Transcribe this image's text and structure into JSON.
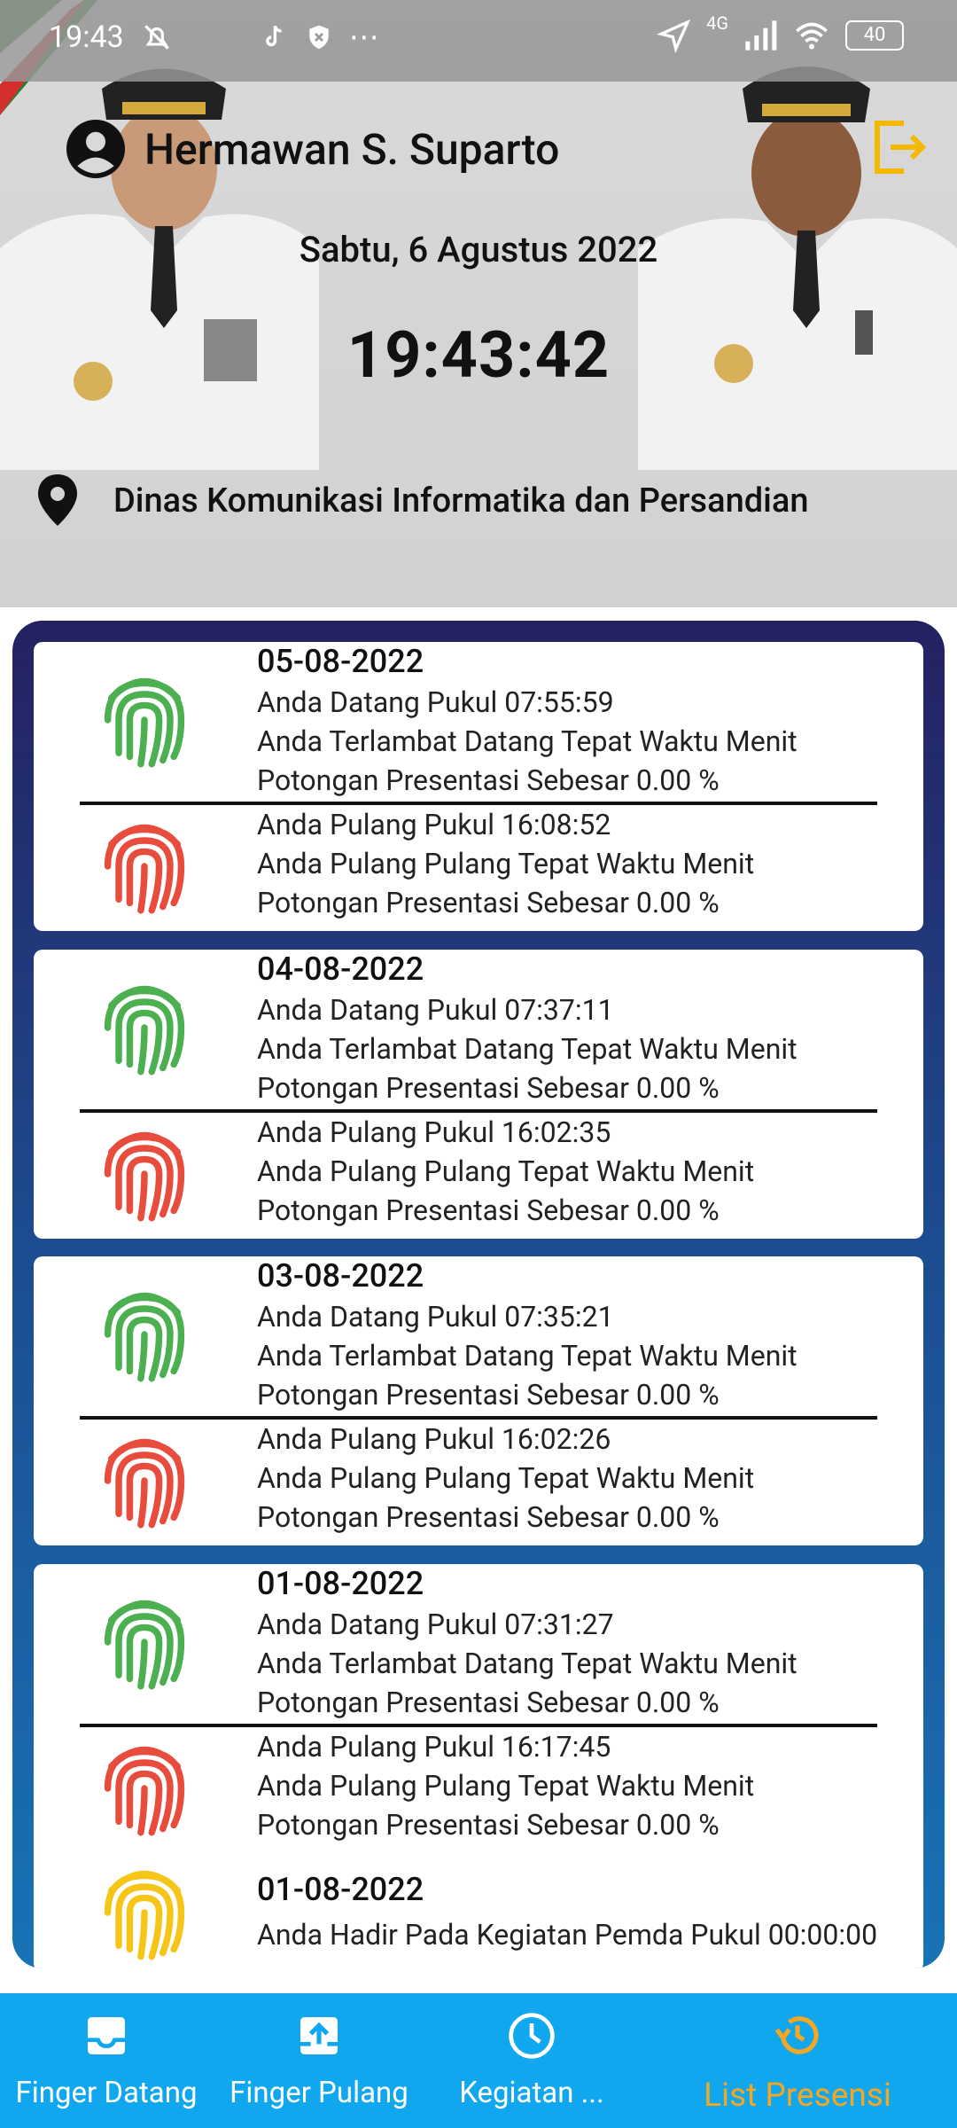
{
  "status_bar": {
    "time": "19:43",
    "network": "4G",
    "battery": "40"
  },
  "header": {
    "user_name": "Hermawan S. Suparto",
    "date": "Sabtu, 6 Agustus 2022",
    "clock": "19:43:42",
    "location": "Dinas Komunikasi Informatika dan Persandian"
  },
  "records": [
    {
      "date": "05-08-2022",
      "in": {
        "line1": "Anda Datang Pukul 07:55:59",
        "line2": "Anda Terlambat Datang Tepat Waktu Menit",
        "line3": "Potongan Presentasi Sebesar 0.00 %"
      },
      "out": {
        "line1": "Anda Pulang Pukul 16:08:52",
        "line2": "Anda Pulang Pulang Tepat Waktu Menit",
        "line3": "Potongan Presentasi Sebesar 0.00 %"
      }
    },
    {
      "date": "04-08-2022",
      "in": {
        "line1": "Anda Datang Pukul 07:37:11",
        "line2": "Anda Terlambat Datang Tepat Waktu Menit",
        "line3": "Potongan Presentasi Sebesar 0.00 %"
      },
      "out": {
        "line1": "Anda Pulang Pukul 16:02:35",
        "line2": "Anda Pulang Pulang Tepat Waktu Menit",
        "line3": "Potongan Presentasi Sebesar 0.00 %"
      }
    },
    {
      "date": "03-08-2022",
      "in": {
        "line1": "Anda Datang Pukul 07:35:21",
        "line2": "Anda Terlambat Datang Tepat Waktu Menit",
        "line3": "Potongan Presentasi Sebesar 0.00 %"
      },
      "out": {
        "line1": "Anda Pulang Pukul 16:02:26",
        "line2": "Anda Pulang Pulang Tepat Waktu Menit",
        "line3": "Potongan Presentasi Sebesar 0.00 %"
      }
    },
    {
      "date": "01-08-2022",
      "in": {
        "line1": "Anda Datang Pukul 07:31:27",
        "line2": "Anda Terlambat Datang Tepat Waktu Menit",
        "line3": "Potongan Presentasi Sebesar 0.00 %"
      },
      "out": {
        "line1": "Anda Pulang Pukul 16:17:45",
        "line2": "Anda Pulang Pulang Tepat Waktu Menit",
        "line3": "Potongan Presentasi Sebesar 0.00 %"
      },
      "event": {
        "date": "01-08-2022",
        "line1": "Anda Hadir Pada Kegiatan Pemda Pukul 00:00:00"
      }
    }
  ],
  "nav": [
    {
      "label": "Finger Datang",
      "icon": "inbox-icon"
    },
    {
      "label": "Finger Pulang",
      "icon": "upload-box-icon"
    },
    {
      "label": "Kegiatan ...",
      "icon": "clock-icon"
    },
    {
      "label": "List Presensi",
      "icon": "history-icon",
      "active": true
    }
  ],
  "colors": {
    "in_icon": "#4caf50",
    "out_icon": "#e84c3d",
    "event_icon": "#f5c518",
    "active_nav": "#f5a623",
    "nav_bg": "#11a7ee",
    "logout_icon": "#f5b800"
  }
}
